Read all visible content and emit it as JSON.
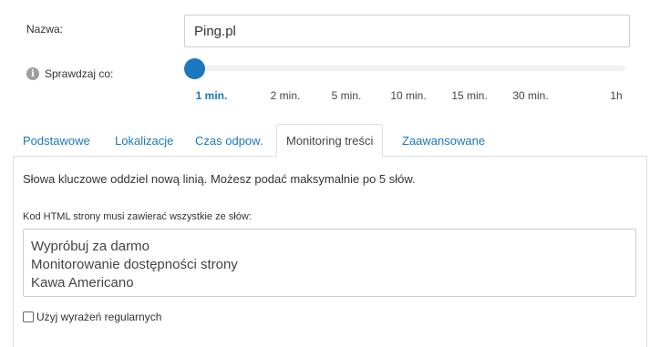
{
  "form": {
    "name_label": "Nazwa:",
    "name_value": "Ping.pl",
    "check_label": "Sprawdzaj co:",
    "interval_options": [
      "1 min.",
      "2 min.",
      "5 min.",
      "10 min.",
      "15 min.",
      "30 min.",
      "1h"
    ],
    "selected_interval": "1 min."
  },
  "tabs": [
    {
      "label": "Podstawowe",
      "active": false
    },
    {
      "label": "Lokalizacje",
      "active": false
    },
    {
      "label": "Czas odpow.",
      "active": false
    },
    {
      "label": "Monitoring treści",
      "active": true
    },
    {
      "label": "Zaawansowane",
      "active": false
    }
  ],
  "panel": {
    "description": "Słowa kluczowe oddziel nową linią. Możesz podać maksymalnie po 5 słów.",
    "keywords_label": "Kod HTML strony musi zawierać wszystkie ze słów:",
    "keywords_value": "Wypróbuj za darmo\nMonitorowanie dostępności strony\nKawa Americano",
    "regex_label": "Użyj wyrażeń regularnych",
    "regex_checked": false
  },
  "colors": {
    "accent": "#1a77c0",
    "border": "#dedede"
  },
  "icons": {
    "info": "info-icon"
  }
}
